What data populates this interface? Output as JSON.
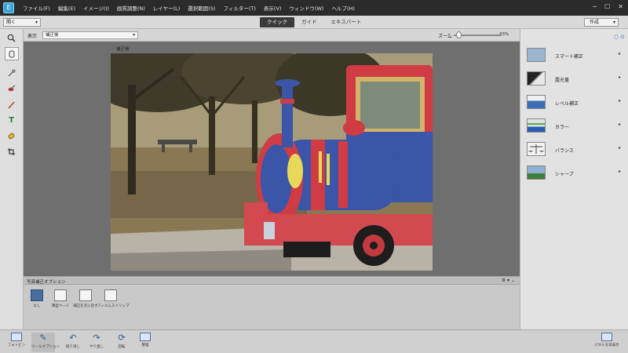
{
  "menubar": {
    "items": [
      "ファイル(F)",
      "編集(E)",
      "イメージ(I)",
      "画質調整(N)",
      "レイヤー(L)",
      "選択範囲(S)",
      "フィルター(T)",
      "表示(V)",
      "ウィンドウ(W)",
      "ヘルプ(H)"
    ]
  },
  "modebar": {
    "open_label": "開く",
    "tabs": [
      "クイック",
      "ガイド",
      "エキスパート"
    ],
    "active_tab": "クイック",
    "create_label": "作成"
  },
  "options": {
    "view_label": "表示",
    "view_value": "補正後",
    "zoom_label": "ズーム",
    "zoom_value": "33%",
    "zoom_fraction": 0.1
  },
  "canvas": {
    "caption": "補正後"
  },
  "photobin": {
    "title": "写真補正オプション",
    "items": [
      "なし",
      "薄型ページ",
      "補正を元に戻す",
      "フィルムストリップ"
    ]
  },
  "adjustments": {
    "items": [
      "スマート補正",
      "露光量",
      "レベル補正",
      "カラー",
      "バランス",
      "シャープ"
    ]
  },
  "taskbar": {
    "left": [
      "フォトビン",
      "ツールオプション",
      "取り消し",
      "やり直し",
      "回転",
      "整理"
    ],
    "right": "パネルを非表示"
  },
  "colors": {
    "dark_bar": "#2b2b2b",
    "canvas_bg": "#6f6f6f",
    "accent": "#3aa5d8"
  }
}
